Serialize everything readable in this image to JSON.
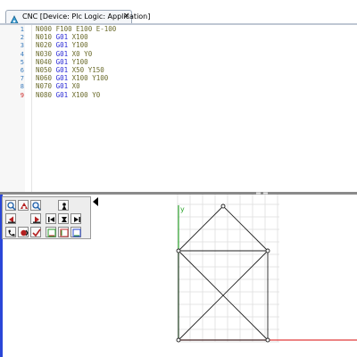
{
  "tab": {
    "title": "CNC [Device: Plc Logic: Application]",
    "close": "×",
    "icon": "cnc-editor-icon"
  },
  "editor": {
    "lines": [
      {
        "num": "1",
        "tokens": [
          {
            "t": "N000 ",
            "g": false
          },
          {
            "t": "F100 E100 E-100",
            "g": false
          }
        ]
      },
      {
        "num": "2",
        "tokens": [
          {
            "t": "N010 ",
            "g": false
          },
          {
            "t": "G01",
            "g": true
          },
          {
            "t": " X100",
            "g": false
          }
        ]
      },
      {
        "num": "3",
        "tokens": [
          {
            "t": "N020 ",
            "g": false
          },
          {
            "t": "G01",
            "g": true
          },
          {
            "t": " Y100",
            "g": false
          }
        ]
      },
      {
        "num": "4",
        "tokens": [
          {
            "t": "N030 ",
            "g": false
          },
          {
            "t": "G01",
            "g": true
          },
          {
            "t": " X0 Y0",
            "g": false
          }
        ]
      },
      {
        "num": "5",
        "tokens": [
          {
            "t": "N040 ",
            "g": false
          },
          {
            "t": "G01",
            "g": true
          },
          {
            "t": " Y100",
            "g": false
          }
        ]
      },
      {
        "num": "6",
        "tokens": [
          {
            "t": "N050 ",
            "g": false
          },
          {
            "t": "G01",
            "g": true
          },
          {
            "t": " X50 Y150",
            "g": false
          }
        ]
      },
      {
        "num": "7",
        "tokens": [
          {
            "t": "N060 ",
            "g": false
          },
          {
            "t": "G01",
            "g": true
          },
          {
            "t": " X100 Y100",
            "g": false
          }
        ]
      },
      {
        "num": "8",
        "tokens": [
          {
            "t": "N070 ",
            "g": false
          },
          {
            "t": "G01",
            "g": true
          },
          {
            "t": " X0",
            "g": false
          }
        ]
      },
      {
        "num": "9",
        "tokens": [
          {
            "t": "N080 ",
            "g": false
          },
          {
            "t": "G01",
            "g": true
          },
          {
            "t": " X100 Y0",
            "g": false
          }
        ]
      }
    ],
    "error_line": "9"
  },
  "toolbar": {
    "rows": [
      [
        "zoom-in-icon",
        "zoom-fit-icon",
        "zoom-out-icon",
        "",
        "pawn-icon"
      ],
      [
        "move-left-icon",
        "",
        "move-right-icon",
        "step-back-icon",
        "step-icon",
        "step-forward-icon"
      ],
      [
        "phone-icon",
        "record-icon",
        "checkmark-icon",
        "xy-plane-icon",
        "xz-plane-icon",
        "yz-plane-icon"
      ]
    ],
    "collapse_icon": "collapse-arrow-icon"
  },
  "preview": {
    "y_axis_label": "y",
    "path": [
      [
        0,
        0
      ],
      [
        100,
        0
      ],
      [
        100,
        100
      ],
      [
        0,
        0
      ],
      [
        0,
        100
      ],
      [
        50,
        150
      ],
      [
        100,
        100
      ],
      [
        0,
        100
      ],
      [
        100,
        0
      ]
    ],
    "colors": {
      "grid": "#dcdcdc",
      "path": "#222222",
      "x_axis": "#e03a3a",
      "y_axis": "#2fa52f"
    }
  }
}
